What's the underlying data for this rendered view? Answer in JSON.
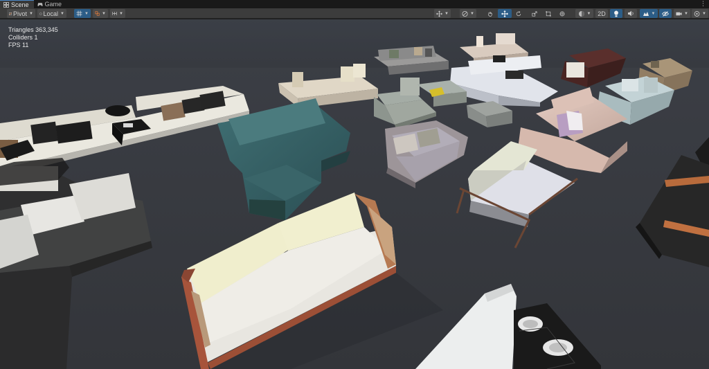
{
  "tabs": [
    {
      "label": "Scene",
      "icon": "scene-grid-icon",
      "active": true
    },
    {
      "label": "Game",
      "icon": "gamepad-icon",
      "active": false
    }
  ],
  "toolbar": {
    "pivot_label": "Pivot",
    "local_label": "Local",
    "mode_2d_label": "2D",
    "icons": [
      "grid-icon",
      "snap-icon",
      "increment-snap-icon",
      "move-tool-icon",
      "view-tool-icon",
      "hand-tool-icon",
      "move-gizmo-icon",
      "rotate-tool-icon",
      "rect-tool-icon",
      "transform-tool-icon",
      "shading-mode-icon",
      "lighting-icon",
      "audio-icon",
      "effects-icon",
      "hidden-objects-icon",
      "camera-icon",
      "gizmos-icon"
    ]
  },
  "stats": {
    "triangles": "Triangles 363,345",
    "colliders": "Colliders 1",
    "fps": "FPS 11"
  },
  "colors": {
    "tab_active_accent": "#4c88c8",
    "toolbar_bg": "#3c3c3c",
    "selected_button": "#2c5d87",
    "viewport_floor": "#383b42"
  }
}
